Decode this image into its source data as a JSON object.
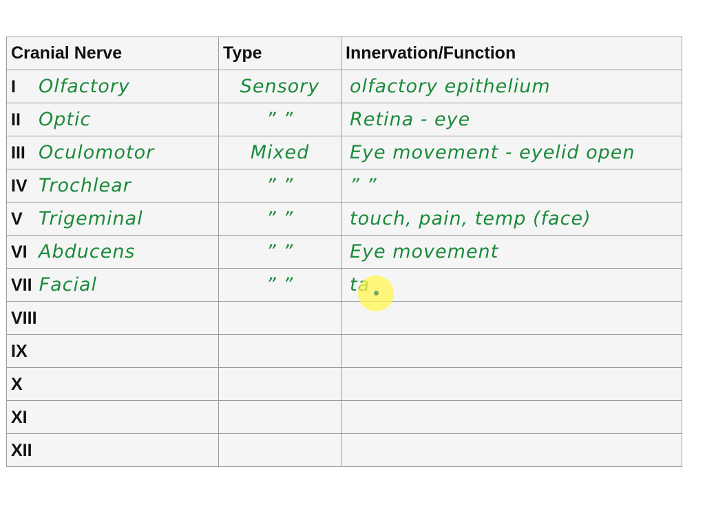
{
  "table": {
    "headers": [
      "Cranial Nerve",
      "Type",
      "Innervation/Function"
    ],
    "rows": [
      {
        "numeral": "I",
        "name": "Olfactory",
        "type": "Sensory",
        "function": "olfactory epithelium"
      },
      {
        "numeral": "II",
        "name": "Optic",
        "type": "” ”",
        "function": "Retina - eye"
      },
      {
        "numeral": "III",
        "name": "Oculomotor",
        "type": "Mixed",
        "function": "Eye movement - eyelid open"
      },
      {
        "numeral": "IV",
        "name": "Trochlear",
        "type": "” ”",
        "function": "” ”"
      },
      {
        "numeral": "V",
        "name": "Trigeminal",
        "type": "” ”",
        "function": "touch, pain, temp (face)"
      },
      {
        "numeral": "VI",
        "name": "Abducens",
        "type": "” ”",
        "function": "Eye movement"
      },
      {
        "numeral": "VII",
        "name": "Facial",
        "type": "” ”",
        "function": "ta"
      },
      {
        "numeral": "VIII",
        "name": "",
        "type": "",
        "function": ""
      },
      {
        "numeral": "IX",
        "name": "",
        "type": "",
        "function": ""
      },
      {
        "numeral": "X",
        "name": "",
        "type": "",
        "function": ""
      },
      {
        "numeral": "XI",
        "name": "",
        "type": "",
        "function": ""
      },
      {
        "numeral": "XII",
        "name": "",
        "type": "",
        "function": ""
      }
    ]
  },
  "colors": {
    "handwriting": "#1b8a3a",
    "border": "#9a9a9a",
    "cell_bg": "#f5f5f5",
    "cursor_highlight": "#fff550"
  }
}
